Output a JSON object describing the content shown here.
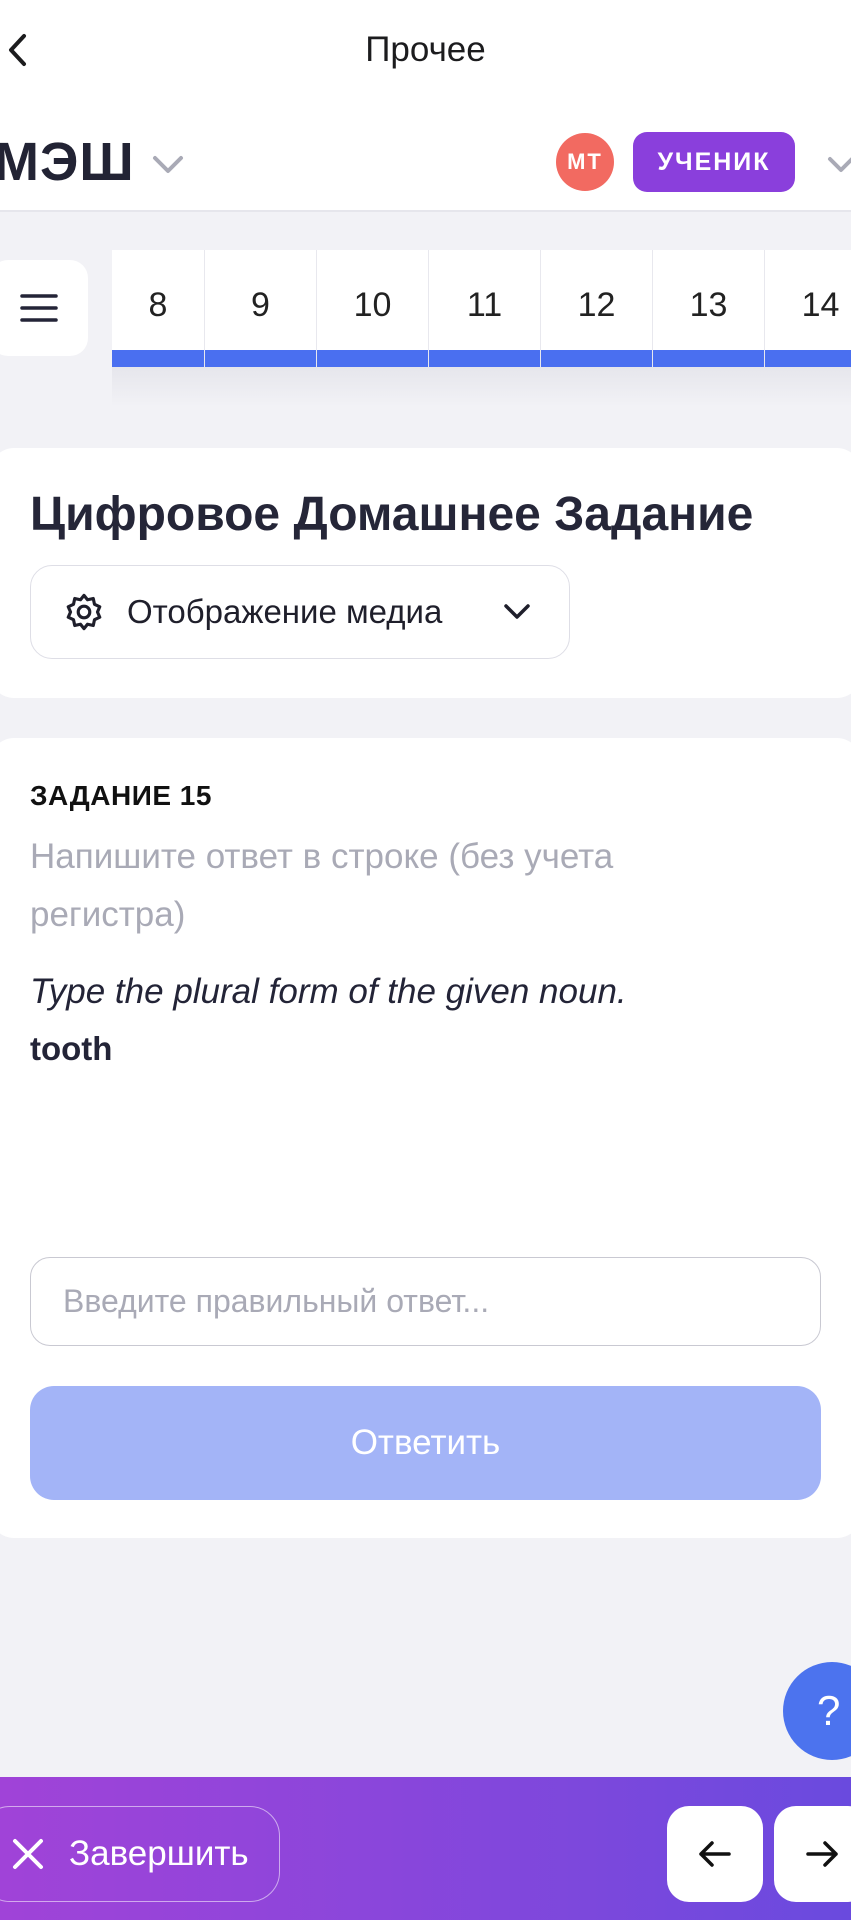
{
  "topbar": {
    "title": "Прочее"
  },
  "header": {
    "brand": "МЭШ",
    "avatar_initials": "МТ",
    "role_label": "УЧЕНИК"
  },
  "task_nav": {
    "numbers": [
      "8",
      "9",
      "10",
      "11",
      "12",
      "13",
      "14"
    ],
    "accent_color": "#4a6ff0"
  },
  "main": {
    "page_title": "Цифровое Домашнее Задание",
    "media_dropdown_label": "Отображение медиа"
  },
  "task": {
    "label": "ЗАДАНИЕ 15",
    "instruction": "Напишите ответ в строке (без учета регистра)",
    "question": "Type the plural form of the given noun.",
    "word": "tooth",
    "answer_placeholder": "Введите правильный ответ...",
    "answer_value": "",
    "submit_label": "Ответить"
  },
  "help": {
    "label": "?"
  },
  "bottom_bar": {
    "finish_label": "Завершить"
  },
  "icons": [
    "back-icon",
    "chevron-down-icon",
    "menu-icon",
    "gear-icon",
    "close-icon",
    "arrow-left-icon",
    "arrow-right-icon"
  ]
}
